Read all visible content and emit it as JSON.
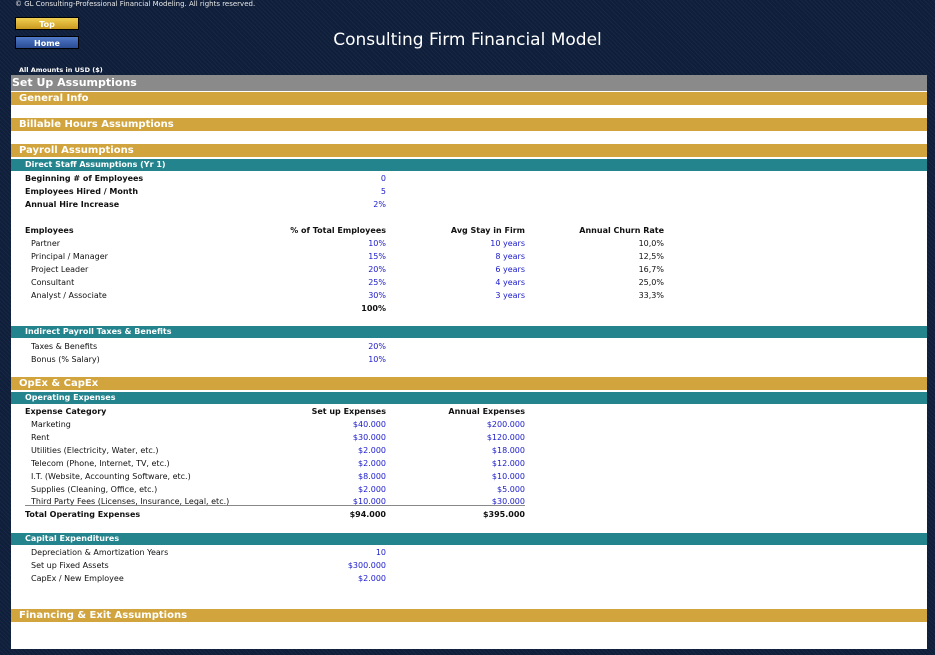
{
  "copyright": "© GL Consulting-Professional Financial Modeling. All rights reserved.",
  "nav": {
    "top_label": "Top",
    "home_label": "Home"
  },
  "title": "Consulting Firm Financial Model",
  "amounts_note": "All Amounts in  USD ($)",
  "sections": {
    "setup": "Set Up Assumptions",
    "general": "General Info",
    "billable": "Billable Hours Assumptions",
    "payroll": "Payroll Assumptions",
    "opex_capex": "OpEx & CapEx",
    "financing": "Financing & Exit Assumptions"
  },
  "direct_staff": {
    "header": "Direct Staff Assumptions (Yr 1)",
    "rows": [
      {
        "label": "Beginning # of Employees",
        "value": "0"
      },
      {
        "label": "Employees Hired / Month",
        "value": "5"
      },
      {
        "label": "Annual Hire Increase",
        "value": "2%"
      }
    ]
  },
  "employees": {
    "headers": [
      "Employees",
      "% of Total Employees",
      "Avg Stay in Firm",
      "Annual Churn Rate"
    ],
    "rows": [
      {
        "role": "Partner",
        "pct": "10%",
        "stay": "10 years",
        "churn": "10,0%"
      },
      {
        "role": "Principal / Manager",
        "pct": "15%",
        "stay": "8 years",
        "churn": "12,5%"
      },
      {
        "role": "Project Leader",
        "pct": "20%",
        "stay": "6 years",
        "churn": "16,7%"
      },
      {
        "role": "Consultant",
        "pct": "25%",
        "stay": "4 years",
        "churn": "25,0%"
      },
      {
        "role": "Analyst / Associate",
        "pct": "30%",
        "stay": "3 years",
        "churn": "33,3%"
      }
    ],
    "total_pct": "100%"
  },
  "indirect": {
    "header": "Indirect Payroll Taxes & Benefits",
    "rows": [
      {
        "label": "Taxes & Benefits",
        "value": "20%"
      },
      {
        "label": "Bonus (% Salary)",
        "value": "10%"
      }
    ]
  },
  "opex": {
    "header": "Operating Expenses",
    "headers": [
      "Expense Category",
      "Set up Expenses",
      "Annual Expenses"
    ],
    "rows": [
      {
        "label": "Marketing",
        "setup": "$40.000",
        "annual": "$200.000"
      },
      {
        "label": "Rent",
        "setup": "$30.000",
        "annual": "$120.000"
      },
      {
        "label": "Utilities (Electricity, Water, etc.)",
        "setup": "$2.000",
        "annual": "$18.000"
      },
      {
        "label": "Telecom (Phone, Internet, TV, etc.)",
        "setup": "$2.000",
        "annual": "$12.000"
      },
      {
        "label": "I.T. (Website, Accounting Software, etc.)",
        "setup": "$8.000",
        "annual": "$10.000"
      },
      {
        "label": "Supplies (Cleaning, Office, etc.)",
        "setup": "$2.000",
        "annual": "$5.000"
      },
      {
        "label": "Third Party Fees (Licenses, Insurance, Legal, etc.)",
        "setup": "$10.000",
        "annual": "$30.000"
      }
    ],
    "total": {
      "label": "Total Operating Expenses",
      "setup": "$94.000",
      "annual": "$395.000"
    }
  },
  "capex": {
    "header": "Capital Expenditures",
    "rows": [
      {
        "label": "Depreciation & Amortization Years",
        "value": "10"
      },
      {
        "label": "Set up Fixed Assets",
        "value": "$300.000"
      },
      {
        "label": "CapEx / New Employee",
        "value": "$2.000"
      }
    ]
  },
  "colors": {
    "background": "#0f1e3a",
    "gold": "#d1a43e",
    "teal": "#24848d",
    "gray": "#8a8a8a",
    "input_blue": "#1a1acc"
  }
}
